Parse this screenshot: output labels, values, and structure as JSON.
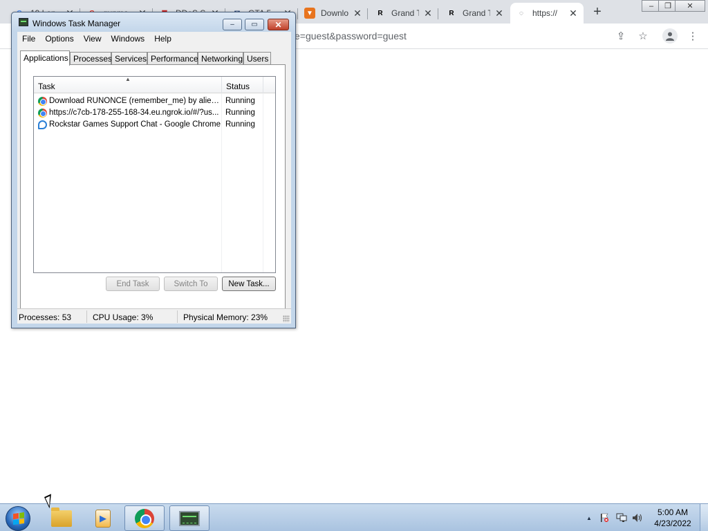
{
  "browser": {
    "tabs": [
      {
        "title": "19 Lon",
        "icon": "google-icon",
        "icon_color": "#4285f4"
      },
      {
        "title": "gupmo",
        "icon": "gmail-icon",
        "icon_color": "#d93025"
      },
      {
        "title": "DDoS S",
        "icon": "shield-icon",
        "icon_color": "#c62828"
      },
      {
        "title": "GTA 5",
        "icon": "email-icon",
        "icon_color": "#1a3a6c"
      },
      {
        "title": "Downlo",
        "icon": "download-site-icon",
        "icon_color": "#e8741e"
      },
      {
        "title": "Grand T",
        "icon": "rockstar-icon",
        "icon_color": "#000000"
      },
      {
        "title": "Grand T",
        "icon": "rockstar-icon",
        "icon_color": "#000000"
      },
      {
        "title": "https://",
        "icon": "loading-icon",
        "icon_color": "#5f6368"
      }
    ],
    "new_tab_glyph": "+",
    "close_glyph": "✕",
    "url_visible": "e=guest&password=guest",
    "window_controls": {
      "minimize": "–",
      "restore": "❐",
      "close": "✕"
    }
  },
  "task_manager": {
    "title": "Windows Task Manager",
    "window_controls": {
      "minimize": "–",
      "maximize": "▭",
      "close": "✕"
    },
    "menu": [
      "File",
      "Options",
      "View",
      "Windows",
      "Help"
    ],
    "tabs": [
      "Applications",
      "Processes",
      "Services",
      "Performance",
      "Networking",
      "Users"
    ],
    "active_tab": "Applications",
    "columns": {
      "task": "Task",
      "status": "Status"
    },
    "tasks": [
      {
        "name": "Download RUNONCE (remember_me) by alienme...",
        "status": "Running",
        "icon": "chrome-icon"
      },
      {
        "name": "https://c7cb-178-255-168-34.eu.ngrok.io/#/?us...",
        "status": "Running",
        "icon": "chrome-icon"
      },
      {
        "name": "Rockstar Games Support Chat - Google Chrome",
        "status": "Running",
        "icon": "chat-icon"
      }
    ],
    "buttons": {
      "end_task": "End Task",
      "switch_to": "Switch To",
      "new_task": "New Task..."
    },
    "status_bar": {
      "processes": "Processes: 53",
      "cpu": "CPU Usage: 3%",
      "memory": "Physical Memory: 23%"
    }
  },
  "taskbar": {
    "apps": [
      {
        "name": "Windows Explorer",
        "icon": "folder-icon",
        "running": false
      },
      {
        "name": "Windows Media Player",
        "icon": "media-player-icon",
        "running": false
      },
      {
        "name": "Google Chrome",
        "icon": "chrome-icon",
        "running": true
      },
      {
        "name": "Task Manager",
        "icon": "task-manager-icon",
        "running": true
      }
    ],
    "tray": {
      "show_hidden_glyph": "▲"
    },
    "clock": {
      "time": "5:00 AM",
      "date": "4/23/2022"
    }
  }
}
